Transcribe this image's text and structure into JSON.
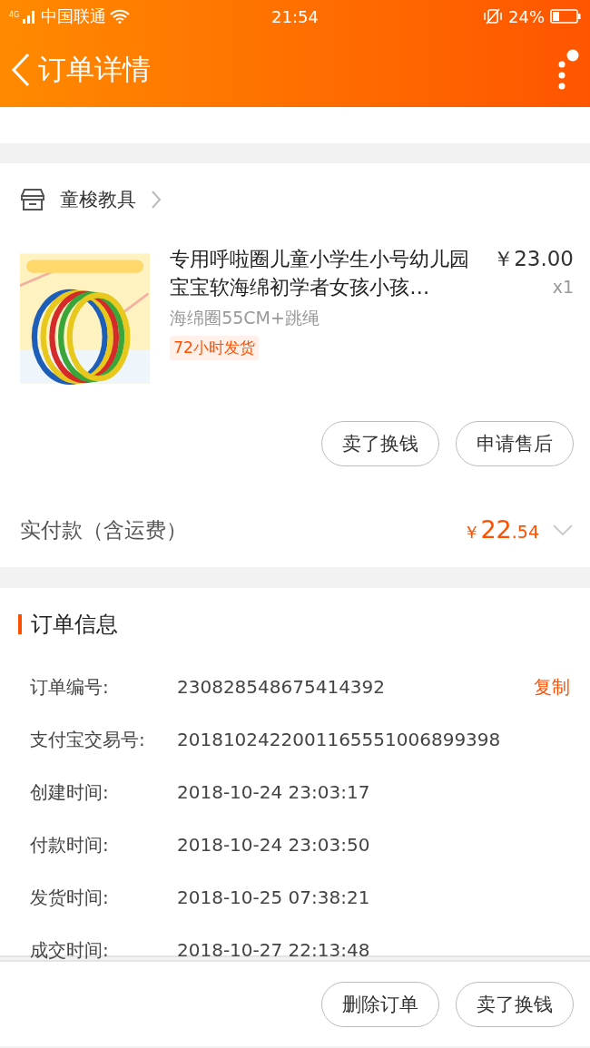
{
  "status_bar": {
    "network": "4G",
    "carrier": "中国联通",
    "time": "21:54",
    "battery": "24%"
  },
  "header": {
    "title": "订单详情"
  },
  "shop": {
    "name": "童梭教具"
  },
  "item": {
    "title": "专用呼啦圈儿童小学生小号幼儿园宝宝软海绵初学者女孩小孩…",
    "price": "￥23.00",
    "quantity": "x1",
    "sku": "海绵圈55CM+跳绳",
    "tag": "72小时发货"
  },
  "item_actions": [
    "卖了换钱",
    "申请售后"
  ],
  "payment": {
    "label": "实付款（含运费）",
    "currency": "￥",
    "amount": "22",
    "cents": ".54"
  },
  "order_info": {
    "title": "订单信息",
    "rows": [
      {
        "label": "订单编号:",
        "value": "230828548675414392",
        "action": "复制"
      },
      {
        "label": "支付宝交易号:",
        "value": "2018102422001165551006899398"
      },
      {
        "label": "创建时间:",
        "value": "2018-10-24 23:03:17"
      },
      {
        "label": "付款时间:",
        "value": "2018-10-24 23:03:50"
      },
      {
        "label": "发货时间:",
        "value": "2018-10-25 07:38:21"
      },
      {
        "label": "成交时间:",
        "value": "2018-10-27 22:13:48"
      }
    ]
  },
  "bottom_actions": [
    "删除订单",
    "卖了换钱"
  ]
}
